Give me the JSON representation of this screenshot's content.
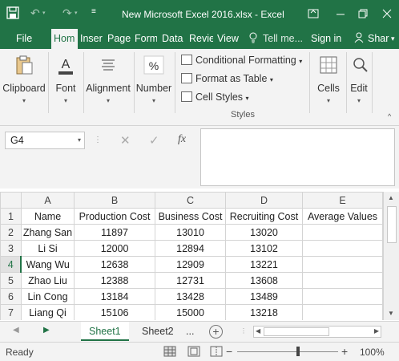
{
  "window": {
    "title": "New Microsoft Excel 2016.xlsx - Excel",
    "controls": [
      "minimize",
      "restore",
      "close"
    ]
  },
  "ribbon_tabs": [
    {
      "label": "File",
      "active": false
    },
    {
      "label": "Hom",
      "active": true
    },
    {
      "label": "Inser",
      "active": false
    },
    {
      "label": "Page",
      "active": false
    },
    {
      "label": "Form",
      "active": false
    },
    {
      "label": "Data",
      "active": false
    },
    {
      "label": "Revie",
      "active": false
    },
    {
      "label": "View",
      "active": false
    }
  ],
  "tell_me": "Tell me...",
  "sign_in": "Sign in",
  "share": "Shar",
  "ribbon": {
    "clipboard": "Clipboard",
    "font": "Font",
    "alignment": "Alignment",
    "number": "Number",
    "conditional_formatting": "Conditional Formatting",
    "format_as_table": "Format as Table",
    "cell_styles": "Cell Styles",
    "styles_group": "Styles",
    "cells": "Cells",
    "editing": "Edit"
  },
  "formula_bar": {
    "name_box": "G4",
    "formula": "",
    "fx": "fx"
  },
  "sheet": {
    "column_headers": [
      "A",
      "B",
      "C",
      "D",
      "E"
    ],
    "rows": [
      {
        "n": "1",
        "cells": [
          "Name",
          "Production Cost",
          "Business Cost",
          "Recruiting Cost",
          "Average Values"
        ]
      },
      {
        "n": "2",
        "cells": [
          "Zhang San",
          "11897",
          "13010",
          "13020",
          ""
        ]
      },
      {
        "n": "3",
        "cells": [
          "Li Si",
          "12000",
          "12894",
          "13102",
          ""
        ]
      },
      {
        "n": "4",
        "cells": [
          "Wang Wu",
          "12638",
          "12909",
          "13221",
          ""
        ]
      },
      {
        "n": "5",
        "cells": [
          "Zhao Liu",
          "12388",
          "12731",
          "13608",
          ""
        ]
      },
      {
        "n": "6",
        "cells": [
          "Lin Cong",
          "13184",
          "13428",
          "13489",
          ""
        ]
      },
      {
        "n": "7",
        "cells": [
          "Liang Qi",
          "15106",
          "15000",
          "13218",
          ""
        ]
      }
    ],
    "selected_row": "4"
  },
  "sheet_tabs": [
    {
      "label": "Sheet1",
      "active": true
    },
    {
      "label": "Sheet2",
      "active": false
    }
  ],
  "sheet_more": "...",
  "status": {
    "ready": "Ready",
    "zoom": "100%",
    "zoom_minus": "−",
    "zoom_plus": "+"
  },
  "colors": {
    "accent": "#217346",
    "ribbon_bg": "#f3f3f3"
  }
}
